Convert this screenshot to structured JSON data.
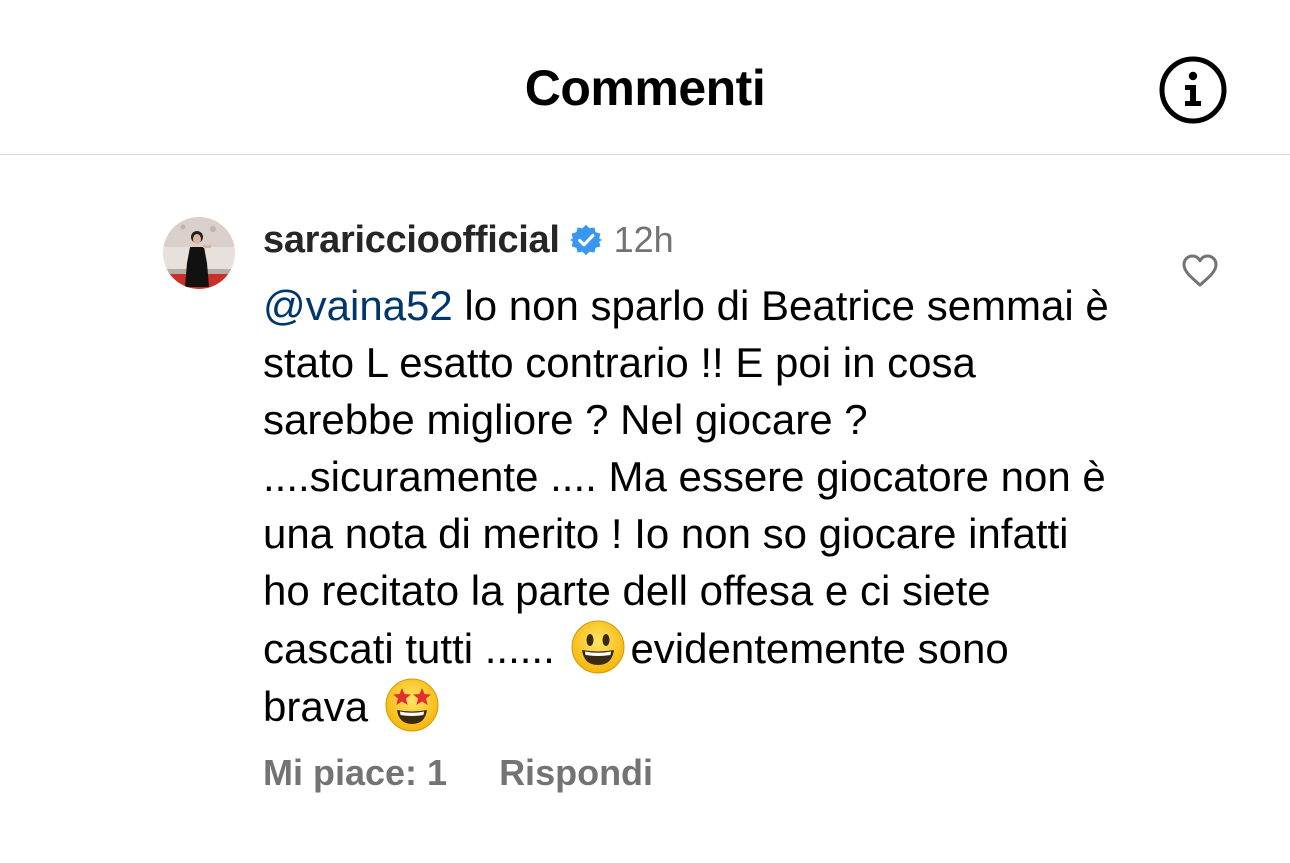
{
  "header": {
    "title": "Commenti",
    "info_icon": "info-circle-icon"
  },
  "comment": {
    "username": "sarariccioofficial",
    "verified": true,
    "timestamp": "12h",
    "mention": "@vaina52",
    "text_part1": " lo non sparlo di Beatrice semmai è stato L esatto contrario !! E poi in cosa sarebbe migliore ? Nel giocare ? ....sicuramente .... Ma essere giocatore non è una nota di merito ! Io non so giocare infatti ho recitato la parte dell offesa e ci siete cascati tutti ...... ",
    "emoji1": "smiley-face-emoji",
    "text_part2": "evidentemente sono brava ",
    "emoji2": "star-struck-emoji",
    "likes_label": "Mi piace: 1",
    "reply_label": "Rispondi",
    "like_icon": "heart-outline-icon"
  },
  "colors": {
    "mention": "#00376b",
    "verified": "#3897f0",
    "secondary_text": "#737373",
    "divider": "#dbdbdb"
  }
}
